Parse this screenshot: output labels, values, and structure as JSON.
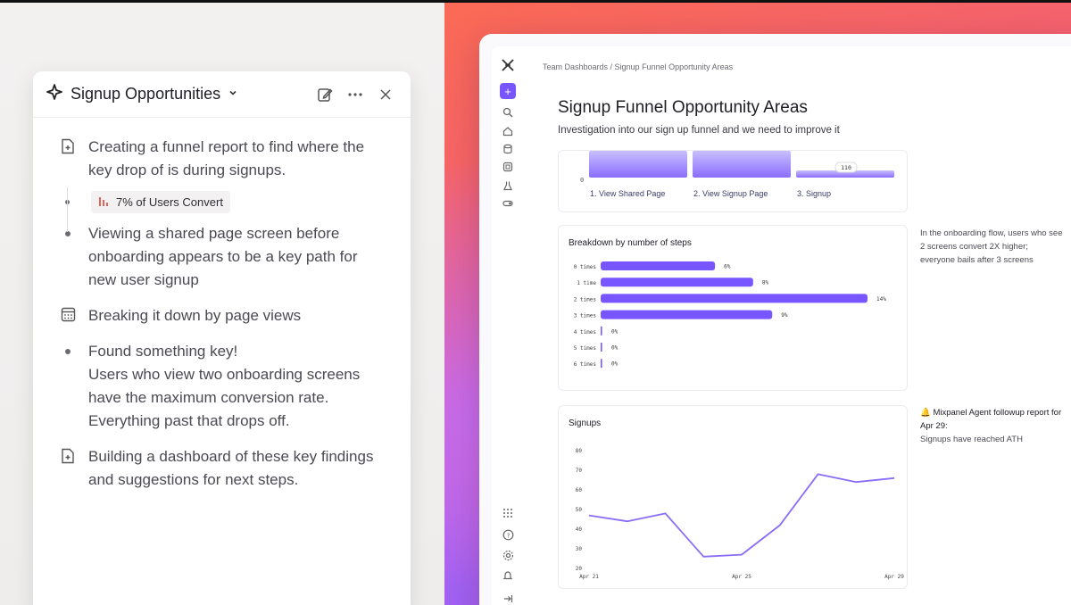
{
  "agent_panel": {
    "title": "Signup Opportunities",
    "steps": [
      {
        "icon": "doc-plus-icon",
        "text": "Creating a funnel report to find where the key drop of is during signups."
      },
      {
        "chip": "7% of Users Convert"
      },
      {
        "icon": "bullet",
        "text": "Viewing a shared page screen before onboarding appears to be a key path for new user signup"
      },
      {
        "icon": "calendar-grid-icon",
        "text": "Breaking it down by page views"
      },
      {
        "icon": "bullet",
        "text": "Found something key!\nUsers who view two onboarding screens have the maximum conversion rate. Everything past that drops off."
      },
      {
        "icon": "doc-plus-icon",
        "text": "Building a dashboard of these key findings and suggestions for next steps."
      }
    ]
  },
  "app": {
    "breadcrumb": "Team Dashboards / Signup Funnel Opportunity Areas",
    "title": "Signup Funnel Opportunity Areas",
    "subtitle": "Investigation into our sign up funnel and we need to improve it",
    "rail_icons": [
      "add-icon",
      "search-icon",
      "home-icon",
      "database-icon",
      "board-icon",
      "flask-icon",
      "toggle-icon",
      "apps-grid-icon",
      "help-icon",
      "settings-icon",
      "bell-icon",
      "collapse-icon"
    ],
    "accent": "#7856ff"
  },
  "chart_data": [
    {
      "type": "bar",
      "title": "",
      "categories": [
        "1. View Shared Page",
        "2. View Signup Page",
        "3. Signup"
      ],
      "y_axis_visible_tick": "0",
      "label_on_last_bar": "110",
      "values": [
        null,
        null,
        110
      ]
    },
    {
      "type": "bar",
      "orientation": "horizontal",
      "title": "Breakdown by number of steps",
      "categories": [
        "0 times",
        "1 time",
        "2 times",
        "3 times",
        "4 times",
        "5 times",
        "6 times"
      ],
      "values": [
        6,
        8,
        14,
        9,
        0,
        0,
        0
      ],
      "value_labels": [
        "6%",
        "8%",
        "14%",
        "9%",
        "0%",
        "0%",
        "0%"
      ],
      "xlim": [
        0,
        14
      ]
    },
    {
      "type": "line",
      "title": "Signups",
      "x_tick_labels": [
        "Apr 21",
        "Apr 25",
        "Apr 29"
      ],
      "x": [
        21,
        22,
        23,
        24,
        25,
        26,
        27,
        28,
        29
      ],
      "y": [
        47,
        44,
        48,
        26,
        27,
        42,
        68,
        64,
        66
      ],
      "ylim": [
        20,
        80
      ],
      "y_ticks": [
        20,
        30,
        40,
        50,
        60,
        70,
        80
      ]
    }
  ],
  "notes": {
    "steps_note": "In the onboarding flow, users who see 2 screens convert 2X higher; everyone bails after 3 screens",
    "followup_title": "🔔 Mixpanel Agent followup report for Apr 29:",
    "followup_body": "Signups have reached ATH"
  }
}
